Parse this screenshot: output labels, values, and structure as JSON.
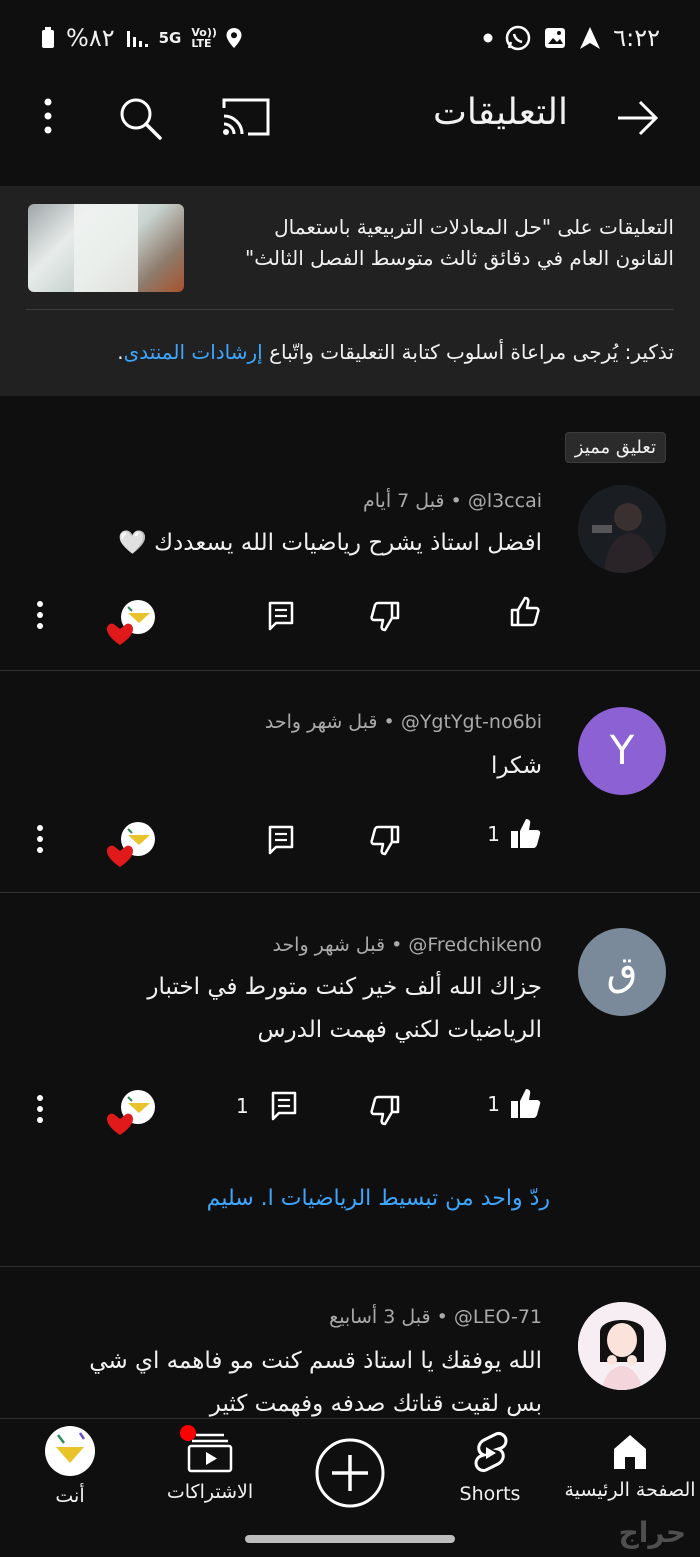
{
  "status": {
    "time": "٦:٢٢",
    "battery": "%٨٢",
    "network": "5G",
    "volte": "Vo)) LTE"
  },
  "header": {
    "title": "التعليقات"
  },
  "video": {
    "title": "التعليقات على \"حل المعادلات التربيعية باستعمال القانون العام  في دقائق ثالث متوسط الفصل الثالث\"",
    "reminder_prefix": "تذكير: يُرجى مراعاة أسلوب كتابة التعليقات واتّباع",
    "reminder_link": "إرشادات المنتدى",
    "reminder_suffix": "."
  },
  "pinned_label": "تعليق مميز",
  "comments": [
    {
      "handle": "@l3ccai",
      "time": "قبل 7 أيام",
      "text": "افضل استاذ يشرح رياضيات الله يسعددك 🤍",
      "likes": "",
      "replies": "",
      "avatar_letter": ""
    },
    {
      "handle": "@YgtYgt-no6bi",
      "time": "قبل شهر واحد",
      "text": "شكرا",
      "likes": "1",
      "replies": "",
      "avatar_letter": "Y"
    },
    {
      "handle": "@Fredchiken0",
      "time": "قبل شهر واحد",
      "text": "جزاك الله ألف خير كنت متورط في اختبار الرياضيات لكني فهمت الدرس",
      "likes": "1",
      "replies": "1",
      "avatar_letter": "ق"
    },
    {
      "handle": "@LEO-71",
      "time": "قبل 3 أسابيع",
      "text": "الله يوفقك يا استاذ قسم كنت مو فاهمه اي شي بس لقيت قناتك صدفه وفهمت كثير",
      "likes": "",
      "replies": "",
      "avatar_letter": ""
    }
  ],
  "reply_link": "ردّ واحد من تبسيط الرياضيات  ا. سليم",
  "nav": {
    "home": "الصفحة الرئيسية",
    "shorts": "Shorts",
    "subscriptions": "الاشتراكات",
    "you": "أنت"
  },
  "watermark": "حراج",
  "colors": {
    "background": "#0f0f0f",
    "link": "#3ea6ff",
    "card": "#212121",
    "avatar_purple": "#8c61d4",
    "avatar_gray": "#7a8a9a"
  }
}
